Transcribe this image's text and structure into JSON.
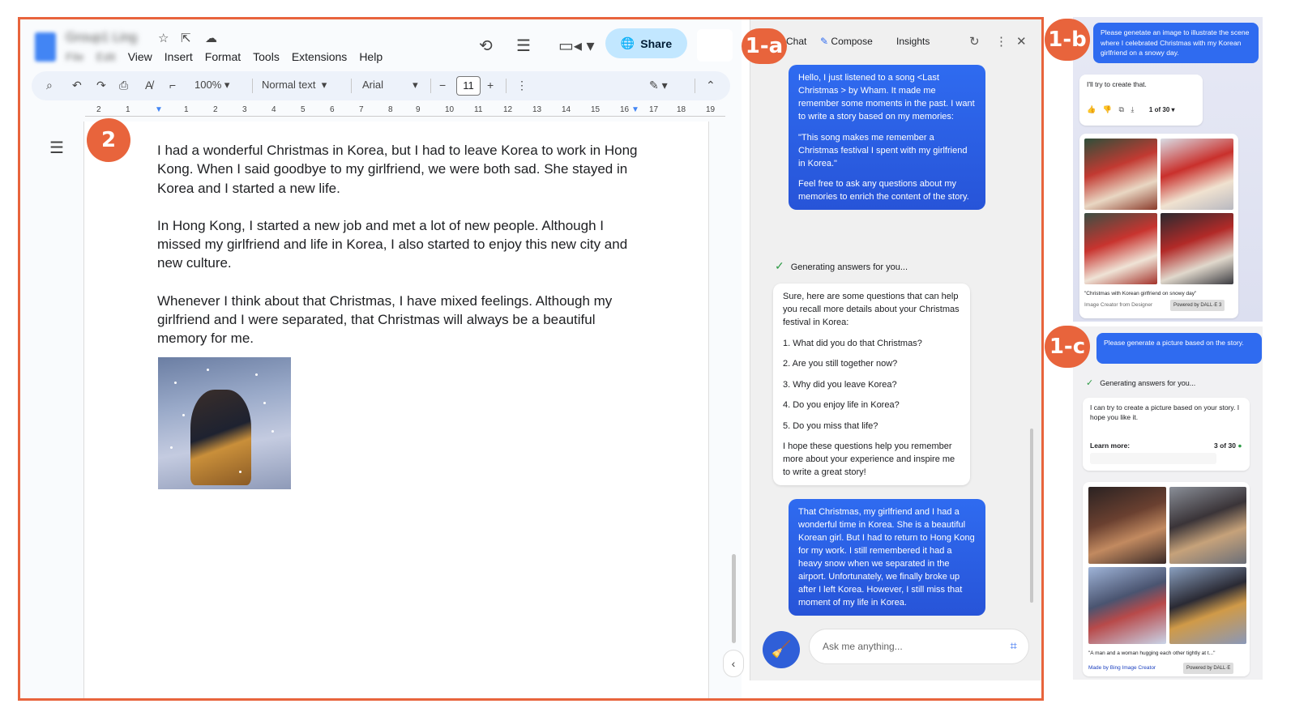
{
  "docs": {
    "title": "Group1 Ling",
    "menu": [
      "File",
      "Edit",
      "View",
      "Insert",
      "Format",
      "Tools",
      "Extensions",
      "Help"
    ],
    "share_label": "Share",
    "toolbar": {
      "zoom": "100%",
      "style": "Normal text",
      "font": "Arial",
      "font_size": "11"
    },
    "ruler_numbers": [
      "2",
      "1",
      "1",
      "2",
      "3",
      "4",
      "5",
      "6",
      "7",
      "8",
      "9",
      "10",
      "11",
      "12",
      "13",
      "14",
      "15",
      "16",
      "17",
      "18",
      "19"
    ],
    "paragraphs": [
      "I had a wonderful Christmas in Korea, but I had to leave Korea to work in Hong Kong. When I said goodbye to my girlfriend, we were both sad. She stayed in Korea and I started a new life.",
      "In Hong Kong, I started a new job and met a lot of new people. Although I missed my girlfriend and life in Korea, I also started to enjoy this new city and new culture.",
      "Whenever I think about that Christmas, I have mixed feelings. Although my girlfriend and I were separated, that Christmas will always be a beautiful memory for me."
    ]
  },
  "chat": {
    "tabs": [
      "Chat",
      "Compose",
      "Insights"
    ],
    "user_message_1": [
      "Hello, I just listened to a song <Last Christmas > by Wham. It made me remember some moments in the past. I want to write a story based on my memories:",
      "\"This song makes me remember a Christmas festival I spent with my girlfriend in Korea.\"",
      "Feel free to ask any questions about my memories to enrich the content of the story."
    ],
    "generating": "Generating answers for you...",
    "bot_reply": {
      "intro": "Sure, here are some questions that can help you recall more details about your Christmas festival in Korea:",
      "questions": [
        "1. What did you do that Christmas?",
        "2. Are you still together now?",
        "3. Why did you leave Korea?",
        "4. Do you enjoy life in Korea?",
        "5. Do you miss that life?"
      ],
      "outro": "I hope these questions help you remember more about your experience and inspire me to write a great story!"
    },
    "user_message_2": "That Christmas, my girlfriend and I had a wonderful time in Korea. She is a beautiful Korean girl. But I had to return to Hong Kong for my work. I still remembered it had a heavy snow when we separated in the airport. Unfortunately, we finally broke up after I left Korea. However, I still miss that moment of my life in Korea.",
    "input_placeholder": "Ask me anything..."
  },
  "panel_b": {
    "user_message": "Please genetate an image to illustrate the scene where I celebrated Christmas with my Korean girlfriend on a snowy day.",
    "bot_message": "I'll try to create that.",
    "counter": "1 of 30",
    "caption": "\"Christmas with Korean girlfriend on snowy day\"",
    "source": "Image Creator from Designer",
    "powered": "Powered by DALL·E 3"
  },
  "panel_c": {
    "user_message": "Please generate a picture based on the story.",
    "generating": "Generating answers for you...",
    "bot_message": "I can try to create a picture based on your story. I hope you like it.",
    "learn_more": "Learn more:",
    "counter": "3 of 30",
    "caption": "\"A man and a woman hugging each other tightly at t...\"",
    "source": "Made by Bing Image Creator",
    "powered": "Powered by DALL·E"
  },
  "badges": {
    "b1a": "1-a",
    "b1b": "1-b",
    "b1c": "1-c",
    "b2": "2"
  },
  "colors": {
    "accent_orange": "#e8643c",
    "chat_blue": "#2f6bf0",
    "share_blue": "#c2e7ff"
  }
}
